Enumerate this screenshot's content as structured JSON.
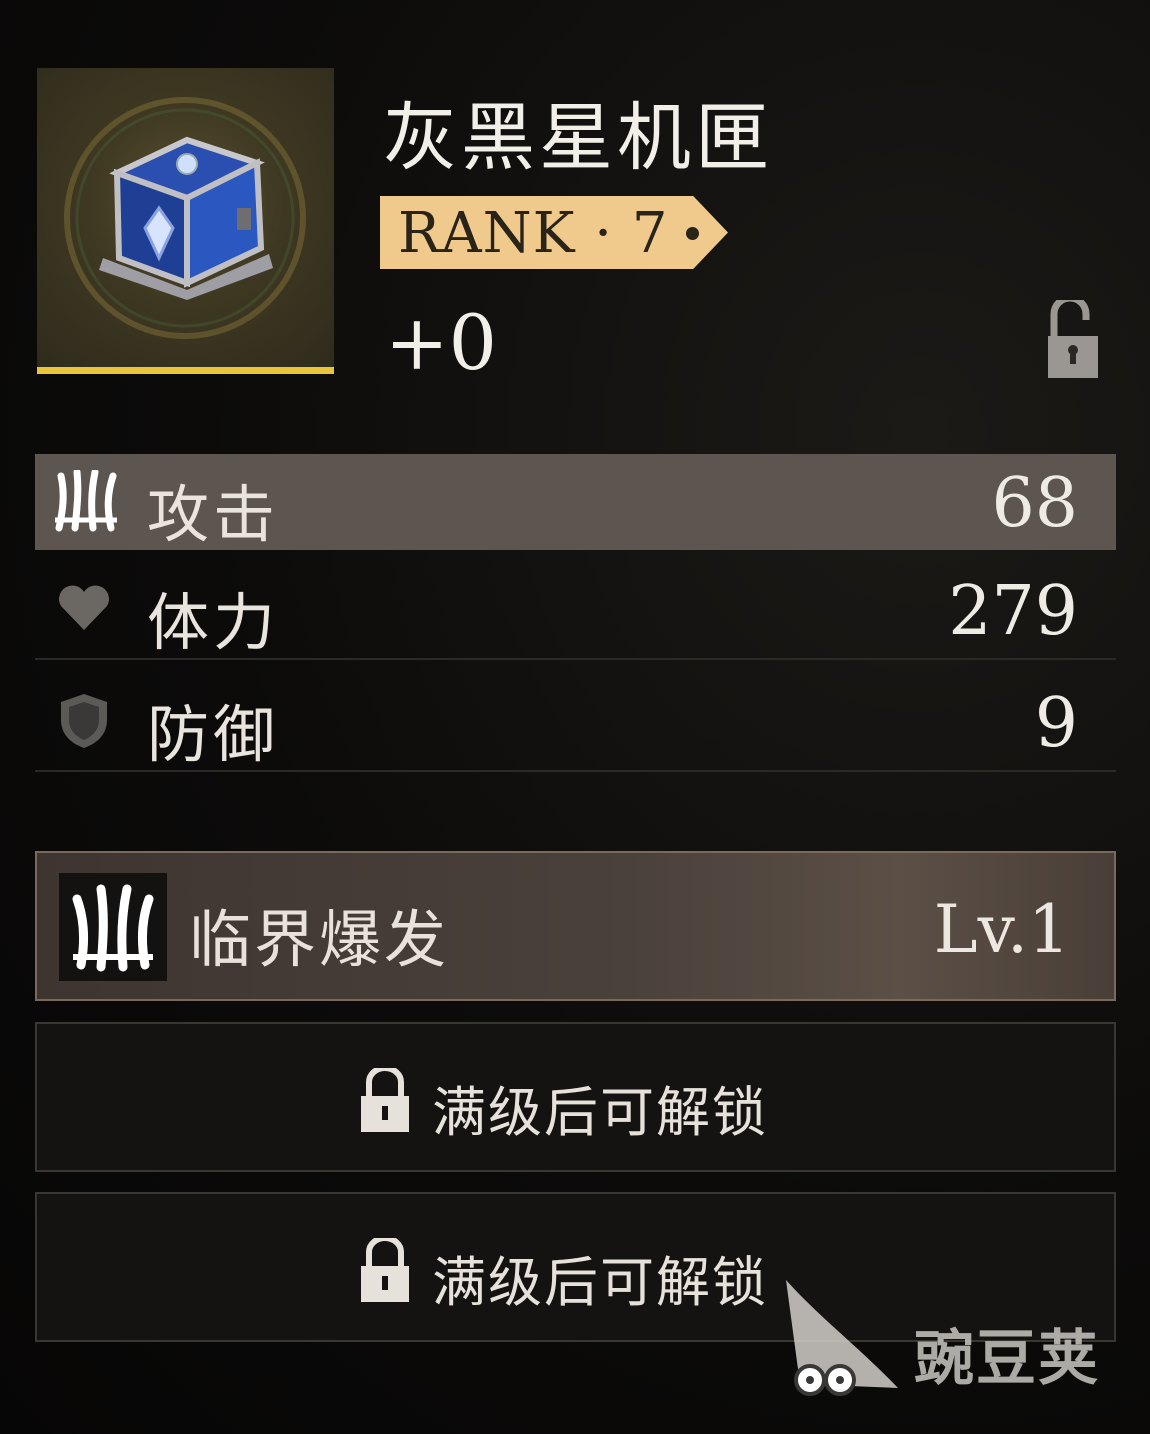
{
  "item": {
    "name": "灰黑星机匣",
    "rank_text": "RANK · 7",
    "enhance": "+0",
    "icon": "treasure-chest-icon",
    "accent_color": "#e8c53a",
    "lock_icon": "padlock-icon"
  },
  "stats": [
    {
      "icon": "claw-attack-icon",
      "label": "攻击",
      "value": "68",
      "highlighted": true
    },
    {
      "icon": "heart-icon",
      "label": "体力",
      "value": "279",
      "highlighted": false
    },
    {
      "icon": "shield-icon",
      "label": "防御",
      "value": "9",
      "highlighted": false
    }
  ],
  "skill": {
    "icon": "claw-skill-icon",
    "name": "临界爆发",
    "level": "Lv.1"
  },
  "locked_slots": [
    {
      "icon": "padlock-icon",
      "text": "满级后可解锁"
    },
    {
      "icon": "padlock-icon",
      "text": "满级后可解锁"
    }
  ],
  "watermark": {
    "text": "豌豆荚",
    "icon": "pea-pod-logo-icon"
  },
  "colors": {
    "rank_tag": "#f0c98c",
    "active_row": "#5c5550"
  }
}
